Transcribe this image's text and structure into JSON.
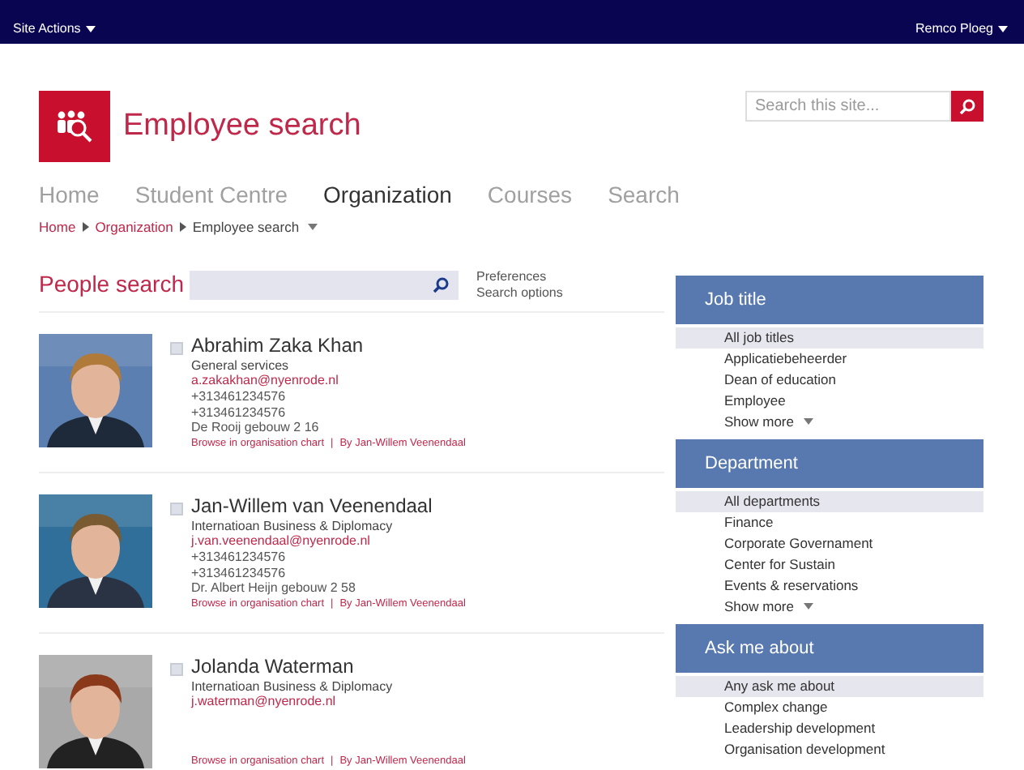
{
  "top_bar": {
    "site_actions": "Site Actions",
    "user": "Remco Ploeg"
  },
  "header": {
    "title": "Employee search",
    "search": {
      "placeholder": "Search this site..."
    }
  },
  "nav": [
    {
      "label": "Home",
      "selected": false
    },
    {
      "label": "Student Centre",
      "selected": false
    },
    {
      "label": "Organization",
      "selected": true
    },
    {
      "label": "Courses",
      "selected": false
    },
    {
      "label": "Search",
      "selected": false
    }
  ],
  "breadcrumb": [
    {
      "label": "Home",
      "kind": "link"
    },
    {
      "label": "Organization",
      "kind": "link"
    },
    {
      "label": "Employee search",
      "kind": "current"
    }
  ],
  "people_search": {
    "title": "People search",
    "links": [
      "Preferences",
      "Search options"
    ]
  },
  "results": [
    {
      "name": "Abrahim Zaka Khan",
      "checked": false,
      "department": "General services",
      "email": "a.zakakhan@nyenrode.nl",
      "phones": [
        "+313461234576",
        "+313461234576"
      ],
      "location": "De Rooij gebouw 2 16",
      "links": [
        "Browse in organisation chart",
        "By Jan-Willem Veenendaal"
      ],
      "separator": "|"
    },
    {
      "name": "Jan-Willem van Veenendaal",
      "checked": false,
      "department": "Internatioan Business & Diplomacy",
      "email": "j.van.veenendaal@nyenrode.nl",
      "phones": [
        "+313461234576",
        "+313461234576"
      ],
      "location": "Dr. Albert Heijn gebouw 2 58",
      "links": [
        "Browse in organisation chart",
        "By Jan-Willem Veenendaal"
      ],
      "separator": "|"
    },
    {
      "name": "Jolanda Waterman",
      "checked": false,
      "department": "Internatioan Business & Diplomacy",
      "email": "j.waterman@nyenrode.nl",
      "links": [
        "Browse in organisation chart",
        "By Jan-Willem Veenendaal"
      ],
      "separator": "|"
    }
  ],
  "facets": [
    {
      "title": "Job title",
      "items": [
        {
          "label": "All job titles",
          "selected": true
        },
        {
          "label": "Applicatiebeheerder",
          "selected": false
        },
        {
          "label": "Dean of education",
          "selected": false
        },
        {
          "label": "Employee",
          "selected": false
        }
      ],
      "show_more": "Show more"
    },
    {
      "title": "Department",
      "items": [
        {
          "label": "All departments",
          "selected": true
        },
        {
          "label": "Finance",
          "selected": false
        },
        {
          "label": "Corporate Governament",
          "selected": false
        },
        {
          "label": "Center for Sustain",
          "selected": false
        },
        {
          "label": "Events & reservations",
          "selected": false
        }
      ],
      "show_more": "Show more"
    },
    {
      "title": "Ask me about",
      "items": [
        {
          "label": "Any ask me about",
          "selected": true
        },
        {
          "label": "Complex change",
          "selected": false
        },
        {
          "label": "Leadership development",
          "selected": false
        },
        {
          "label": "Organisation development",
          "selected": false
        }
      ]
    }
  ]
}
